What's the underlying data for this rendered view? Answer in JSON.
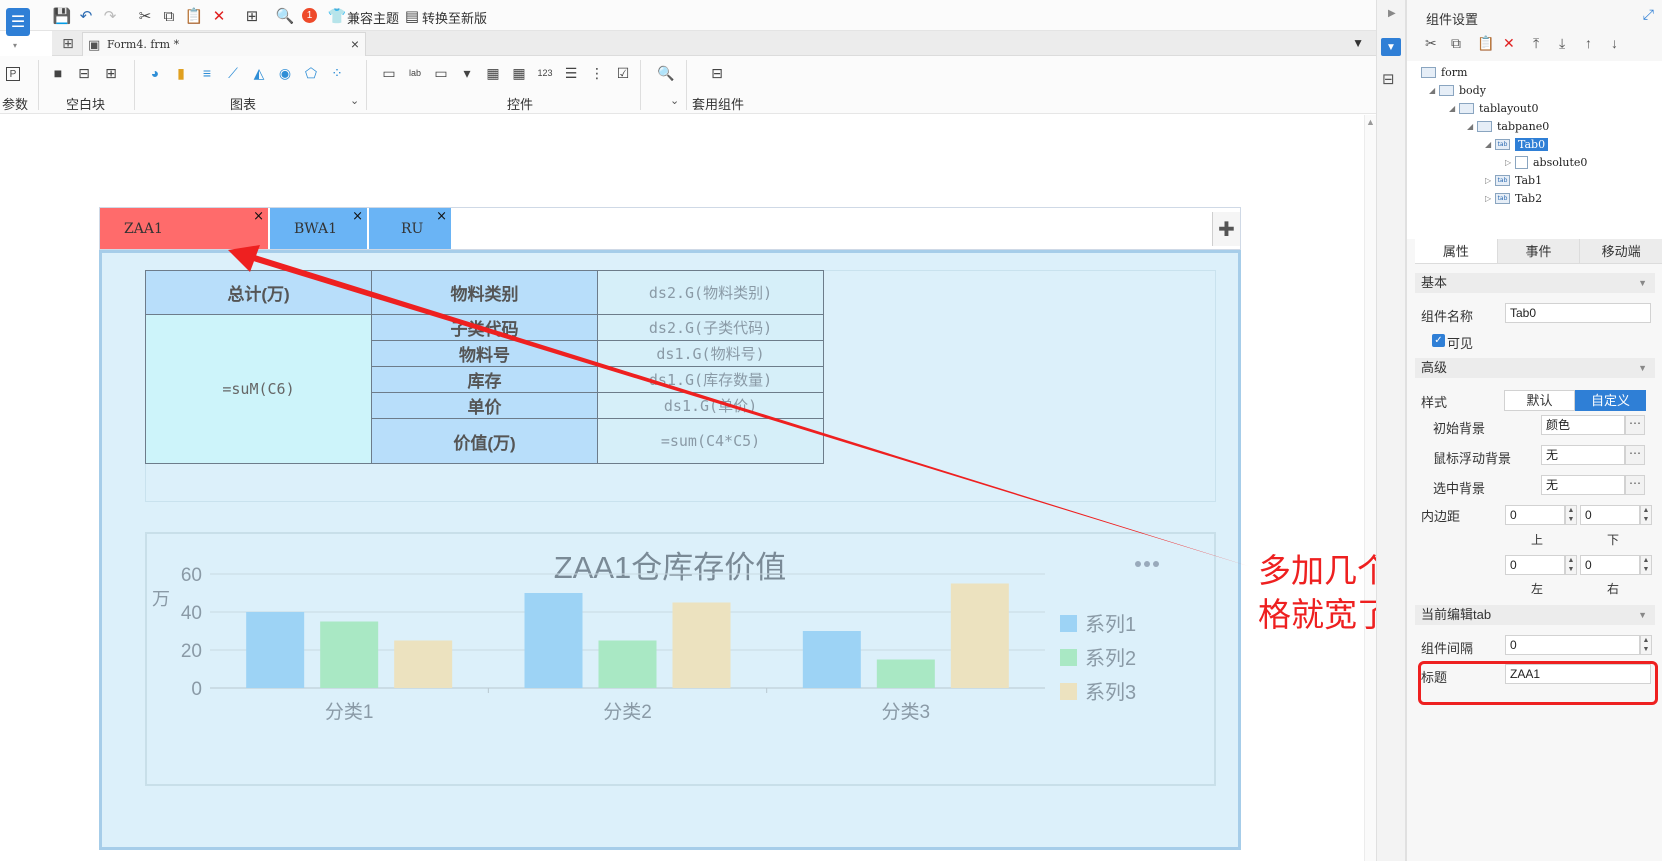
{
  "toolbar": {
    "compat_theme_label": "兼容主题",
    "convert_label": "转换至新版",
    "notification_count": "1"
  },
  "file_tabs": {
    "active_file": "Form4. frm *"
  },
  "ribbon": {
    "param_label": "参数",
    "blank_label": "空白块",
    "chart_label": "图表",
    "widget_label": "控件",
    "preset_label": "套用组件"
  },
  "layout_tabs": [
    {
      "label": "ZAA1",
      "color": "#ff6b6b"
    },
    {
      "label": "BWA1",
      "color": "#6ab4f5"
    },
    {
      "label": "RU",
      "color": "#6ab4f5"
    }
  ],
  "report": {
    "headers": {
      "total": "总计(万)",
      "category": "物料类别",
      "subclass": "子类代码",
      "item_no": "物料号",
      "stock": "库存",
      "price": "单价",
      "value": "价值(万)"
    },
    "cells": {
      "sum_formula": "=suM(C6)",
      "category_formula": "ds2.G(物料类别)",
      "subclass_formula": "ds2.G(子类代码)",
      "item_formula": "ds1.G(物料号)",
      "stock_formula": "ds1.G(库存数量)",
      "price_formula": "ds1.G(单价)",
      "value_formula": "=sum(C4*C5)"
    }
  },
  "chart_data": {
    "type": "bar",
    "title": "ZAA1仓库存价值",
    "ylabel": "万",
    "categories": [
      "分类1",
      "分类2",
      "分类3"
    ],
    "series": [
      {
        "name": "系列1",
        "values": [
          40,
          50,
          30
        ],
        "color": "#9dd3f5"
      },
      {
        "name": "系列2",
        "values": [
          35,
          25,
          15
        ],
        "color": "#a9e8c4"
      },
      {
        "name": "系列3",
        "values": [
          25,
          45,
          55
        ],
        "color": "#ece2bf"
      }
    ],
    "ylim": [
      0,
      60
    ],
    "yticks": [
      0,
      20,
      40,
      60
    ],
    "grid": true,
    "legend": "right"
  },
  "annotation": {
    "text": "多加几个空格就宽了",
    "color": "#ee2020"
  },
  "right_panel": {
    "title": "组件设置",
    "tree": {
      "form": "form",
      "body": "body",
      "tablayout": "tablayout0",
      "tabpane": "tabpane0",
      "tab0": "Tab0",
      "absolute": "absolute0",
      "tab1": "Tab1",
      "tab2": "Tab2"
    },
    "tabs": [
      "属性",
      "事件",
      "移动端"
    ],
    "sections": {
      "basic": "基本",
      "advanced": "高级",
      "current_tab": "当前编辑tab"
    },
    "props": {
      "name_label": "组件名称",
      "name_value": "Tab0",
      "visible_label": "可见",
      "style_label": "样式",
      "style_default": "默认",
      "style_custom": "自定义",
      "init_bg_label": "初始背景",
      "init_bg_value": "颜色",
      "hover_bg_label": "鼠标浮动背景",
      "hover_bg_value": "无",
      "selected_bg_label": "选中背景",
      "selected_bg_value": "无",
      "padding_label": "内边距",
      "pad_top": "0",
      "pad_bottom": "0",
      "pad_left": "0",
      "pad_right": "0",
      "top_label": "上",
      "bottom_label": "下",
      "left_label": "左",
      "right_label": "右",
      "gap_label": "组件间隔",
      "gap_value": "0",
      "title_label": "标题",
      "title_value": "ZAA1"
    }
  },
  "accent_color": "#2f7fd6"
}
